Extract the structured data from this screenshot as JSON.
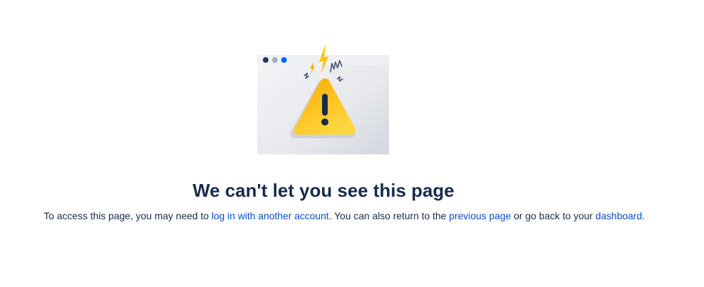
{
  "error": {
    "title": "We can't let you see this page",
    "message": {
      "part1": "To access this page, you may need to ",
      "link_login": "log in with another account",
      "part2": ". You can also return to the ",
      "link_previous": "previous page",
      "part3": " or go back to your ",
      "link_dashboard": "dashboard",
      "part4": "."
    }
  },
  "colors": {
    "heading": "#172b4d",
    "link": "#0052cc",
    "warning_yellow": "#ffc400",
    "dot_blue": "#0065ff"
  },
  "icons": {
    "illustration": "warning-browser-illustration"
  }
}
